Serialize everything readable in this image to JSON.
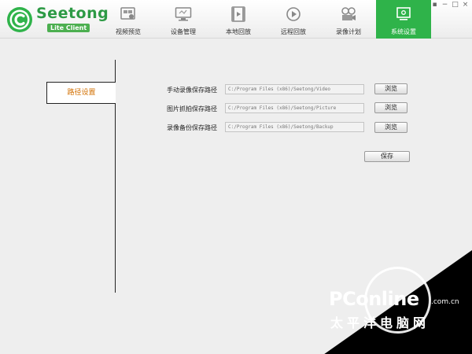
{
  "app": {
    "brand": "Seetong",
    "brand_sub": "Lite Client",
    "colors": {
      "accent": "#2fb34a",
      "brand": "#2d9a45",
      "side_active_text": "#d26f00"
    }
  },
  "nav": [
    {
      "label": "视频预览",
      "icon": "video-preview-icon"
    },
    {
      "label": "设备管理",
      "icon": "device-monitor-icon"
    },
    {
      "label": "本地回放",
      "icon": "film-strip-icon"
    },
    {
      "label": "远程回放",
      "icon": "replay-circle-icon"
    },
    {
      "label": "录像计划",
      "icon": "reel-camera-icon"
    },
    {
      "label": "系统设置",
      "icon": "settings-screen-icon",
      "active": true
    }
  ],
  "window_controls": [
    "▪",
    "−",
    "□",
    "×"
  ],
  "sidebar": {
    "items": [
      {
        "label": "路径设置",
        "active": true
      }
    ]
  },
  "form": {
    "rows": [
      {
        "label": "手动录像保存路径",
        "value": "C:/Program Files (x86)/Seetong/Video",
        "button": "浏览"
      },
      {
        "label": "图片抓拍保存路径",
        "value": "C:/Program Files (x86)/Seetong/Picture",
        "button": "浏览"
      },
      {
        "label": "录像备份保存路径",
        "value": "C:/Program Files (x86)/Seetong/Backup",
        "button": "浏览"
      }
    ],
    "save_label": "保存"
  },
  "watermark": {
    "text": "PConline",
    "domain": ".com.cn",
    "cn": "太平洋电脑网"
  }
}
